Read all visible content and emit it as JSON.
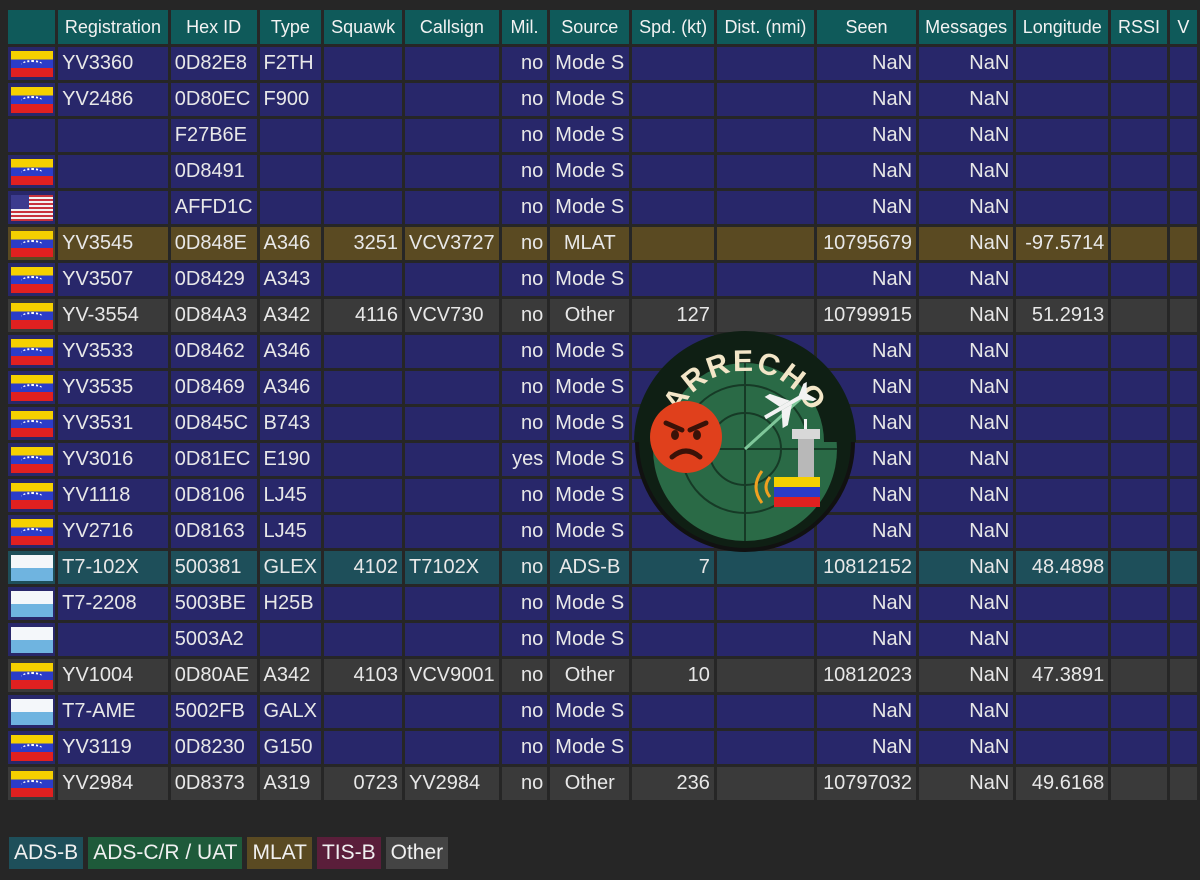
{
  "columns": [
    "",
    "Registration",
    "Hex ID",
    "Type",
    "Squawk",
    "Callsign",
    "Mil.",
    "Source",
    "Spd. (kt)",
    "Dist. (nmi)",
    "Seen",
    "Messages",
    "Longitude",
    "RSSI",
    "V"
  ],
  "rows": [
    {
      "flag": "ve",
      "registration": "YV3360",
      "hex": "0D82E8",
      "type": "F2TH",
      "squawk": "",
      "callsign": "",
      "mil": "no",
      "source": "Mode S",
      "speed": "",
      "dist": "",
      "seen": "NaN",
      "messages": "NaN",
      "longitude": "",
      "src": "mode-s"
    },
    {
      "flag": "ve",
      "registration": "YV2486",
      "hex": "0D80EC",
      "type": "F900",
      "squawk": "",
      "callsign": "",
      "mil": "no",
      "source": "Mode S",
      "speed": "",
      "dist": "",
      "seen": "NaN",
      "messages": "NaN",
      "longitude": "",
      "src": "mode-s"
    },
    {
      "flag": "",
      "registration": "",
      "hex": "F27B6E",
      "type": "",
      "squawk": "",
      "callsign": "",
      "mil": "no",
      "source": "Mode S",
      "speed": "",
      "dist": "",
      "seen": "NaN",
      "messages": "NaN",
      "longitude": "",
      "src": "mode-s"
    },
    {
      "flag": "ve",
      "registration": "",
      "hex": "0D8491",
      "type": "",
      "squawk": "",
      "callsign": "",
      "mil": "no",
      "source": "Mode S",
      "speed": "",
      "dist": "",
      "seen": "NaN",
      "messages": "NaN",
      "longitude": "",
      "src": "mode-s"
    },
    {
      "flag": "us",
      "registration": "",
      "hex": "AFFD1C",
      "type": "",
      "squawk": "",
      "callsign": "",
      "mil": "no",
      "source": "Mode S",
      "speed": "",
      "dist": "",
      "seen": "NaN",
      "messages": "NaN",
      "longitude": "",
      "src": "mode-s"
    },
    {
      "flag": "ve",
      "registration": "YV3545",
      "hex": "0D848E",
      "type": "A346",
      "squawk": "3251",
      "callsign": "VCV3727",
      "mil": "no",
      "source": "MLAT",
      "speed": "",
      "dist": "",
      "seen": "10795679",
      "messages": "NaN",
      "longitude": "-97.5714",
      "src": "mlat"
    },
    {
      "flag": "ve",
      "registration": "YV3507",
      "hex": "0D8429",
      "type": "A343",
      "squawk": "",
      "callsign": "",
      "mil": "no",
      "source": "Mode S",
      "speed": "",
      "dist": "",
      "seen": "NaN",
      "messages": "NaN",
      "longitude": "",
      "src": "mode-s"
    },
    {
      "flag": "ve",
      "registration": "YV-3554",
      "hex": "0D84A3",
      "type": "A342",
      "squawk": "4116",
      "callsign": "VCV730",
      "mil": "no",
      "source": "Other",
      "speed": "127",
      "dist": "",
      "seen": "10799915",
      "messages": "NaN",
      "longitude": "51.2913",
      "src": "other"
    },
    {
      "flag": "ve",
      "registration": "YV3533",
      "hex": "0D8462",
      "type": "A346",
      "squawk": "",
      "callsign": "",
      "mil": "no",
      "source": "Mode S",
      "speed": "",
      "dist": "",
      "seen": "NaN",
      "messages": "NaN",
      "longitude": "",
      "src": "mode-s"
    },
    {
      "flag": "ve",
      "registration": "YV3535",
      "hex": "0D8469",
      "type": "A346",
      "squawk": "",
      "callsign": "",
      "mil": "no",
      "source": "Mode S",
      "speed": "",
      "dist": "",
      "seen": "NaN",
      "messages": "NaN",
      "longitude": "",
      "src": "mode-s"
    },
    {
      "flag": "ve",
      "registration": "YV3531",
      "hex": "0D845C",
      "type": "B743",
      "squawk": "",
      "callsign": "",
      "mil": "no",
      "source": "Mode S",
      "speed": "",
      "dist": "",
      "seen": "NaN",
      "messages": "NaN",
      "longitude": "",
      "src": "mode-s"
    },
    {
      "flag": "ve",
      "registration": "YV3016",
      "hex": "0D81EC",
      "type": "E190",
      "squawk": "",
      "callsign": "",
      "mil": "yes",
      "source": "Mode S",
      "speed": "",
      "dist": "",
      "seen": "NaN",
      "messages": "NaN",
      "longitude": "",
      "src": "mode-s"
    },
    {
      "flag": "ve",
      "registration": "YV1118",
      "hex": "0D8106",
      "type": "LJ45",
      "squawk": "",
      "callsign": "",
      "mil": "no",
      "source": "Mode S",
      "speed": "",
      "dist": "",
      "seen": "NaN",
      "messages": "NaN",
      "longitude": "",
      "src": "mode-s"
    },
    {
      "flag": "ve",
      "registration": "YV2716",
      "hex": "0D8163",
      "type": "LJ45",
      "squawk": "",
      "callsign": "",
      "mil": "no",
      "source": "Mode S",
      "speed": "",
      "dist": "",
      "seen": "NaN",
      "messages": "NaN",
      "longitude": "",
      "src": "mode-s"
    },
    {
      "flag": "sm",
      "registration": "T7-102X",
      "hex": "500381",
      "type": "GLEX",
      "squawk": "4102",
      "callsign": "T7102X",
      "mil": "no",
      "source": "ADS-B",
      "speed": "7",
      "dist": "",
      "seen": "10812152",
      "messages": "NaN",
      "longitude": "48.4898",
      "src": "adsb"
    },
    {
      "flag": "sm",
      "registration": "T7-2208",
      "hex": "5003BE",
      "type": "H25B",
      "squawk": "",
      "callsign": "",
      "mil": "no",
      "source": "Mode S",
      "speed": "",
      "dist": "",
      "seen": "NaN",
      "messages": "NaN",
      "longitude": "",
      "src": "mode-s"
    },
    {
      "flag": "sm",
      "registration": "",
      "hex": "5003A2",
      "type": "",
      "squawk": "",
      "callsign": "",
      "mil": "no",
      "source": "Mode S",
      "speed": "",
      "dist": "",
      "seen": "NaN",
      "messages": "NaN",
      "longitude": "",
      "src": "mode-s"
    },
    {
      "flag": "ve",
      "registration": "YV1004",
      "hex": "0D80AE",
      "type": "A342",
      "squawk": "4103",
      "callsign": "VCV9001",
      "mil": "no",
      "source": "Other",
      "speed": "10",
      "dist": "",
      "seen": "10812023",
      "messages": "NaN",
      "longitude": "47.3891",
      "src": "other"
    },
    {
      "flag": "sm",
      "registration": "T7-AME",
      "hex": "5002FB",
      "type": "GALX",
      "squawk": "",
      "callsign": "",
      "mil": "no",
      "source": "Mode S",
      "speed": "",
      "dist": "",
      "seen": "NaN",
      "messages": "NaN",
      "longitude": "",
      "src": "mode-s"
    },
    {
      "flag": "ve",
      "registration": "YV3119",
      "hex": "0D8230",
      "type": "G150",
      "squawk": "",
      "callsign": "",
      "mil": "no",
      "source": "Mode S",
      "speed": "",
      "dist": "",
      "seen": "NaN",
      "messages": "NaN",
      "longitude": "",
      "src": "mode-s"
    },
    {
      "flag": "ve",
      "registration": "YV2984",
      "hex": "0D8373",
      "type": "A319",
      "squawk": "0723",
      "callsign": "YV2984",
      "mil": "no",
      "source": "Other",
      "speed": "236",
      "dist": "",
      "seen": "10797032",
      "messages": "NaN",
      "longitude": "49.6168",
      "src": "other"
    }
  ],
  "legend": [
    "ADS-B",
    "ADS-C/R / UAT",
    "MLAT",
    "TIS-B",
    "Other"
  ],
  "logo": {
    "text": "ARRECHO",
    "emoji": "😡",
    "flag_emoji": "🇻🇪"
  },
  "colors": {
    "header": "#0f5a5a",
    "mode_s": "#28276a",
    "mlat": "#5a4a22",
    "other": "#3a3a3a",
    "adsb": "#1e4f5a",
    "adsc": "#1e5a3a",
    "tisb": "#5a1e3a"
  }
}
